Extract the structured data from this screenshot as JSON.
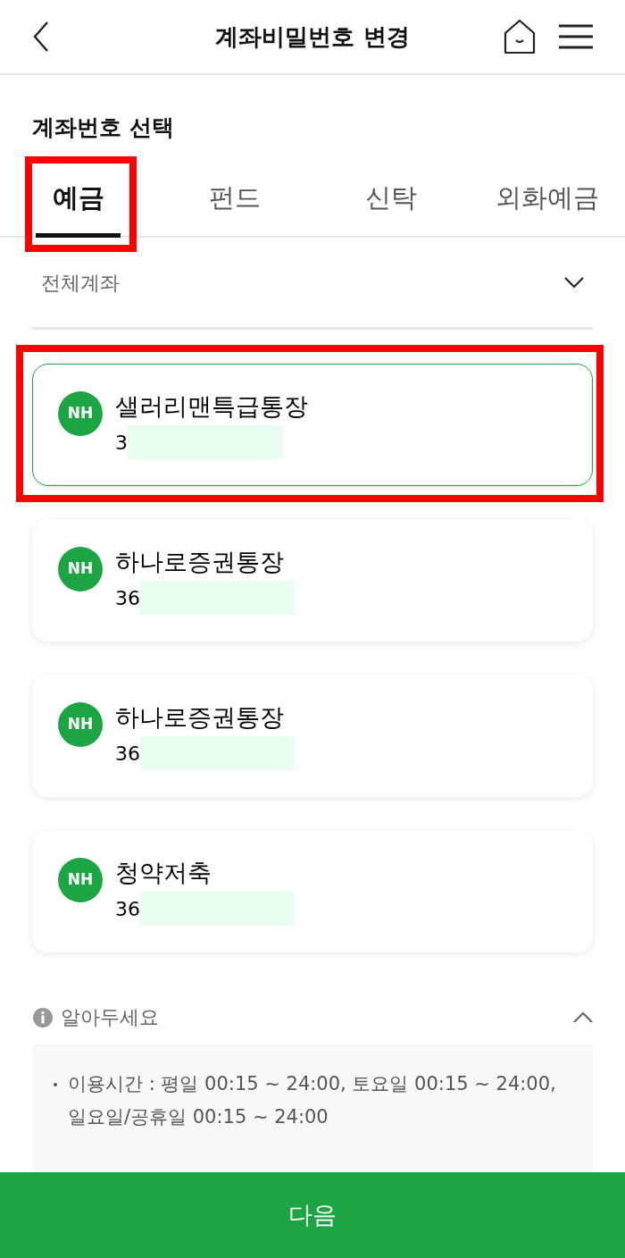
{
  "header": {
    "title": "계좌비밀번호 변경"
  },
  "section_title": "계좌번호 선택",
  "tabs": [
    {
      "label": "예금",
      "selected": true,
      "highlighted": true
    },
    {
      "label": "펀드",
      "selected": false,
      "highlighted": false
    },
    {
      "label": "신탁",
      "selected": false,
      "highlighted": false
    },
    {
      "label": "외화예금",
      "selected": false,
      "highlighted": false
    }
  ],
  "filter": {
    "value": "전체계좌",
    "expanded": false
  },
  "accounts": [
    {
      "bank": "NH",
      "name": "샐러리맨특급통장",
      "number": "3",
      "masked": true,
      "selected": true,
      "highlighted": true
    },
    {
      "bank": "NH",
      "name": "하나로증권통장",
      "number": "36",
      "masked": true,
      "selected": false,
      "highlighted": false
    },
    {
      "bank": "NH",
      "name": "하나로증권통장",
      "number": "36",
      "masked": true,
      "selected": false,
      "highlighted": false
    },
    {
      "bank": "NH",
      "name": "청약저축",
      "number": "36",
      "masked": true,
      "selected": false,
      "highlighted": false
    }
  ],
  "notice": {
    "title": "알아두세요",
    "expanded": true,
    "items": [
      "이용시간 : 평일 00:15 ~ 24:00, 토요일 00:15 ~ 24:00, 일요일/공휴일 00:15 ~ 24:00"
    ]
  },
  "next_button": "다음"
}
